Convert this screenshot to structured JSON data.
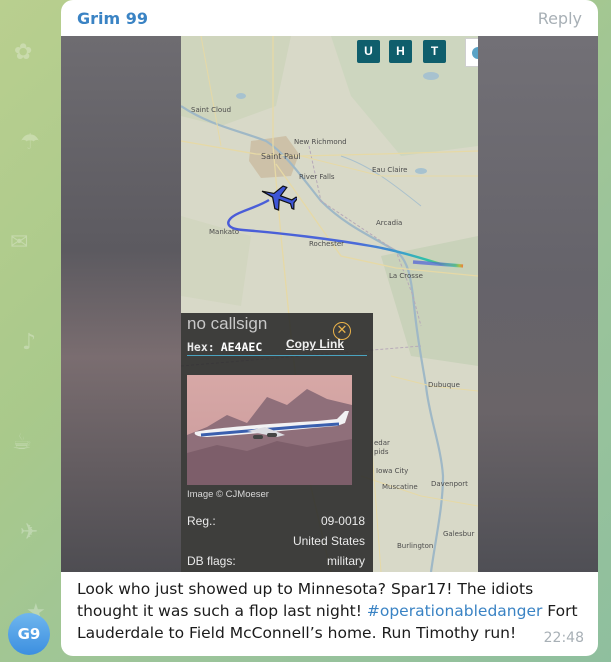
{
  "message": {
    "sender": "Grim 99",
    "reply_label": "Reply",
    "time": "22:48",
    "avatar_initials": "G9",
    "caption": {
      "line1": "Look who just showed up to Minnesota? Spar17! The idiots",
      "line2": "thought it was such a flop last night! ",
      "hashtag": "#operationabledanger",
      "line2_after": " Fort",
      "line3": "Lauderdale to Field McConnell’s home. Run Timothy run!"
    }
  },
  "map": {
    "buttons": [
      "U",
      "H",
      "T"
    ],
    "labels": {
      "saint_cloud": "Saint Cloud",
      "new_richmond": "New Richmond",
      "saint_paul": "Saint Paul",
      "river_falls": "River Falls",
      "eau_claire": "Eau Claire",
      "arcadia": "Arcadia",
      "mankato": "Mankato",
      "rochester": "Rochester",
      "la_crosse": "La Crosse",
      "dubuque": "Dubuque",
      "cedar_rapids_a": "edar",
      "cedar_rapids_b": "pids",
      "iowa_city": "Iowa City",
      "muscatine": "Muscatine",
      "davenport": "Davenport",
      "galesburg": "Galesbur",
      "burlington": "Burlington"
    }
  },
  "aircraft_panel": {
    "callsign": "no callsign",
    "hex_label": "Hex:",
    "hex_value": "AE4AEC",
    "copy_link": "Copy Link",
    "image_credit": "Image © CJMoeser",
    "reg_label": "Reg.:",
    "reg_value": "09-0018",
    "country": "United States",
    "db_flags_label": "DB flags:",
    "db_flags_value": "military",
    "close_symbol": "✕"
  },
  "colors": {
    "sender": "#3a83c4",
    "hashtag": "#3a83c4",
    "track": "#4d63d9",
    "map_button": "#0f5e6c",
    "close_ring": "#e9b24a"
  },
  "icons": {
    "aircraft": "plane-icon",
    "close": "close-icon"
  }
}
